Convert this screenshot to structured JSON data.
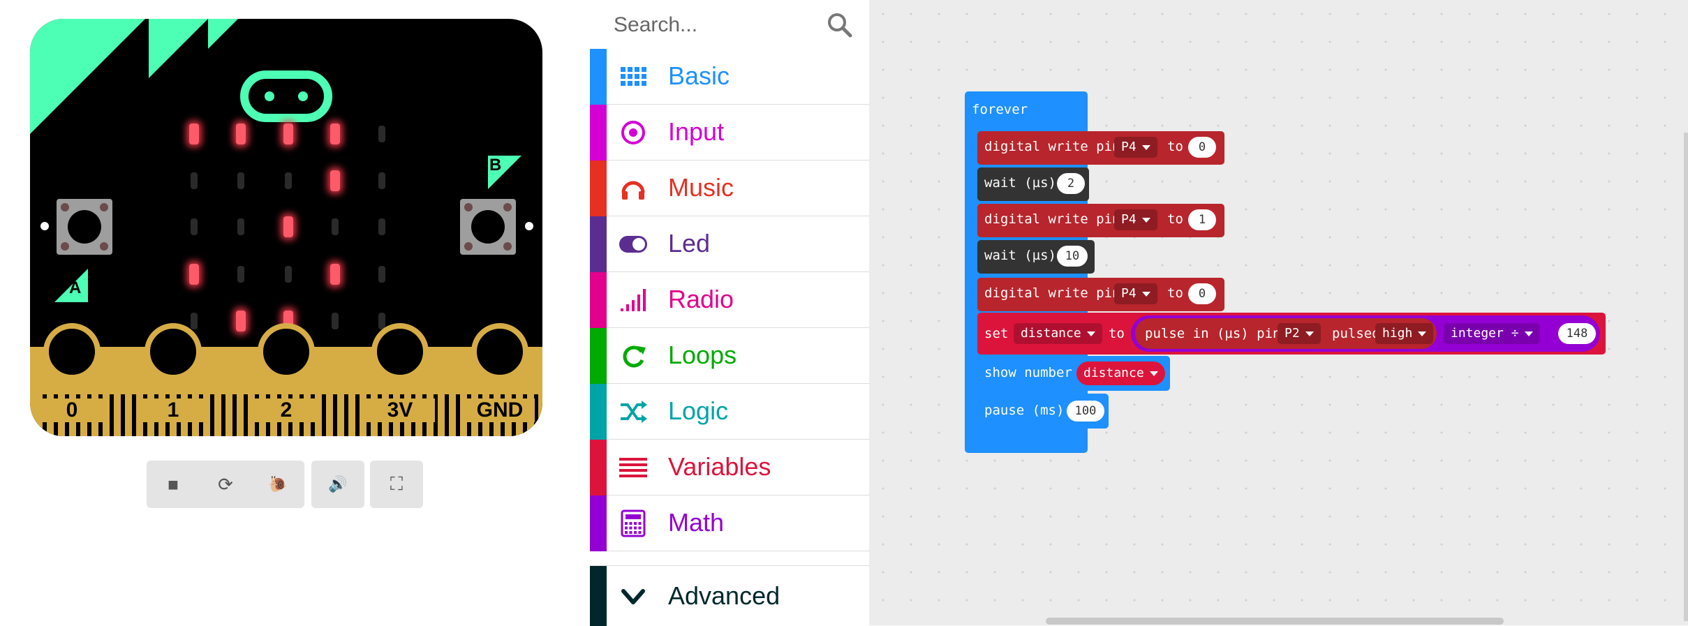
{
  "simulator": {
    "pins": [
      "0",
      "1",
      "2",
      "3V",
      "GND"
    ],
    "button_a": "A",
    "button_b": "B",
    "led_matrix": [
      [
        1,
        1,
        1,
        1,
        0
      ],
      [
        0,
        0,
        0,
        1,
        0
      ],
      [
        0,
        0,
        1,
        0,
        0
      ],
      [
        1,
        0,
        0,
        1,
        0
      ],
      [
        0,
        1,
        1,
        0,
        0
      ]
    ],
    "tools": [
      {
        "name": "stop-icon",
        "glyph": "■"
      },
      {
        "name": "restart-icon",
        "glyph": "⟳"
      },
      {
        "name": "slow-motion-icon",
        "glyph": "🐌"
      },
      {
        "name": "sound-icon",
        "glyph": "🔊"
      },
      {
        "name": "fullscreen-icon",
        "glyph": "⛶"
      }
    ]
  },
  "toolbox": {
    "search_placeholder": "Search...",
    "categories": [
      {
        "label": "Basic",
        "color": "#1e90ff",
        "icon": "grid-icon"
      },
      {
        "label": "Input",
        "color": "#d400d4",
        "icon": "target-icon"
      },
      {
        "label": "Music",
        "color": "#e63022",
        "icon": "headphones-icon"
      },
      {
        "label": "Led",
        "color": "#5c2d91",
        "icon": "toggle-icon"
      },
      {
        "label": "Radio",
        "color": "#e3008c",
        "icon": "signal-icon"
      },
      {
        "label": "Loops",
        "color": "#00aa00",
        "icon": "refresh-icon"
      },
      {
        "label": "Logic",
        "color": "#00a4a6",
        "icon": "shuffle-icon"
      },
      {
        "label": "Variables",
        "color": "#dc143c",
        "icon": "list-icon"
      },
      {
        "label": "Math",
        "color": "#9400d3",
        "icon": "calculator-icon"
      }
    ],
    "advanced": {
      "label": "Advanced",
      "color": "#00272b"
    }
  },
  "blocks": {
    "forever": "forever",
    "dw1": {
      "label": "digital write pin",
      "pin": "P4",
      "to": "to",
      "value": "0"
    },
    "wait1": {
      "label": "wait (µs)",
      "value": "2"
    },
    "dw2": {
      "label": "digital write pin",
      "pin": "P4",
      "to": "to",
      "value": "1"
    },
    "wait2": {
      "label": "wait (µs)",
      "value": "10"
    },
    "dw3": {
      "label": "digital write pin",
      "pin": "P4",
      "to": "to",
      "value": "0"
    },
    "set": {
      "label": "set",
      "variable": "distance",
      "to": "to",
      "pulse_label": "pulse in (µs) pin",
      "pulse_pin": "P2",
      "pulsed": "pulsed",
      "level": "high",
      "op": "integer ÷",
      "divisor": "148"
    },
    "show": {
      "label": "show number",
      "variable": "distance"
    },
    "pause": {
      "label": "pause (ms)",
      "value": "100"
    }
  },
  "colors": {
    "pins_red": "#b8252c",
    "control_dark": "#333333",
    "basic_blue": "#1e90ff",
    "variable_red": "#dc143c",
    "math_purple": "#9400d3"
  }
}
